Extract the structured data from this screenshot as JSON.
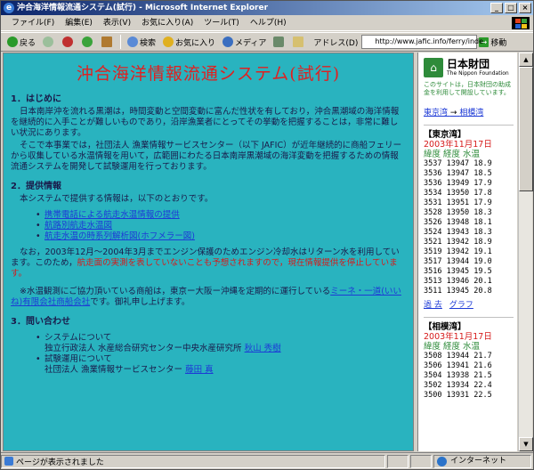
{
  "window": {
    "title": "沖合海洋情報流通システム(試行) - Microsoft Internet Explorer"
  },
  "menu": [
    "ファイル(F)",
    "編集(E)",
    "表示(V)",
    "お気に入り(A)",
    "ツール(T)",
    "ヘルプ(H)"
  ],
  "toolbar": {
    "back": "戻る",
    "search": "検索",
    "favorites": "お気に入り",
    "media": "メディア",
    "address_label": "アドレス(D)",
    "address_value": "http://www.jafic.info/ferry/inde",
    "go": "移動"
  },
  "page": {
    "title": "沖合海洋情報流通システム(試行)",
    "sec1": {
      "heading": "1．はじめに",
      "p1": "日本南岸沖を流れる黒潮は，時間変動と空間変動に富んだ性状を有しており，沖合黒潮域の海洋情報を継続的に入手ことが難しいものであり，沿岸漁業者にとってその挙動を把握することは，非常に難しい状況にあります。",
      "p2": "そこで本事業では，社団法人 漁業情報サービスセンター（以下 JAFIC）が近年継続的に商船フェリーから収集している水温情報を用いて，広範囲にわたる日本南岸黒潮域の海洋変動を把握するための情報流通システムを開発して試験運用を行っております。"
    },
    "sec2": {
      "heading": "2．提供情報",
      "intro": "本システムで提供する情報は，以下のとおりです。",
      "links": [
        "携帯電話による航走水温情報の提供",
        "航路別航走水温図",
        "航走水温の時系列解析図(ホフメラー図)"
      ],
      "note_a": "なお，2003年12月〜2004年3月までエンジン保護のためエンジン冷却水はリターン水を利用しています。このため，",
      "note_red": "航走面の実測を表していないことも予想されますので，現在情報提供を停止しています。",
      "note2_a": "※水温観測にご協力頂いている商船は，東京ー大阪ー沖縄を定期的に運行している",
      "note2_link": "ミーネ・一道(いいね)有限会社商船会社",
      "note2_b": "です。御礼申し上げます。"
    },
    "sec3": {
      "heading": "3．問い合わせ",
      "item1_label": "システムについて",
      "item1_org": "独立行政法人 水産総合研究センター中央水産研究所",
      "item1_person": "秋山 秀樹",
      "item2_label": "試験運用について",
      "item2_org": "社団法人 漁業情報サービスセンター",
      "item2_person": "藤田 真"
    }
  },
  "sidebar": {
    "logo_name": "日本財団",
    "logo_sub": "The Nippon Foundation",
    "note": "このサイトは，日本財団の助成金を利用して開設しています。",
    "route_from": "東京湾",
    "route_arrow": "→",
    "route_to": "相模湾",
    "stations": [
      {
        "name": "【東京湾】",
        "date": "2003年11月17日",
        "header": "緯度 経度 水温",
        "rows": [
          "3537 13947 18.9",
          "3536 13947 18.5",
          "3536 13949 17.9",
          "3534 13950 17.8",
          "3531 13951 17.9",
          "3528 13950 18.3",
          "3526 13948 18.1",
          "3524 13943 18.3",
          "3521 13942 18.9",
          "3519 13942 19.1",
          "3517 13944 19.0",
          "3516 13945 19.5",
          "3513 13946 20.1",
          "3511 13945 20.8"
        ],
        "links": [
          "過 去",
          "グラフ"
        ]
      },
      {
        "name": "【相模湾】",
        "date": "2003年11月17日",
        "header": "緯度 経度 水温",
        "rows": [
          "3508 13944 21.7",
          "3506 13941 21.6",
          "3504 13938 21.5",
          "3502 13934 22.4",
          "3500 13931 22.5"
        ],
        "links": []
      }
    ]
  },
  "status": {
    "left": "ページが表示されました",
    "zone": "インターネット"
  }
}
